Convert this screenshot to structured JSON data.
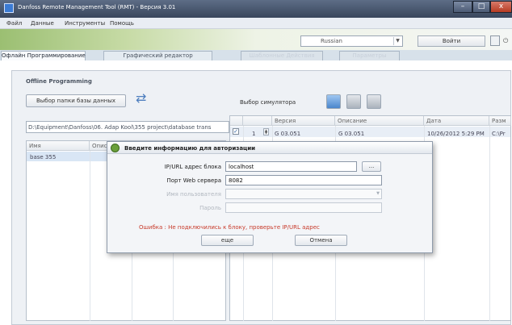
{
  "window": {
    "title": "Danfoss Remote Management Tool (RMT) - Версия 3.01",
    "controls": {
      "minimize": "–",
      "maximize": "□",
      "close": "x"
    }
  },
  "menu": [
    "Файл",
    "Данные",
    "Инструменты",
    "Помощь"
  ],
  "header": {
    "language": "Russian",
    "login_button": "Войти",
    "power_glyph": "⏻"
  },
  "tabs": [
    {
      "label": "Офлайн Программирование",
      "state": "active"
    },
    {
      "label": "Графический редактор",
      "state": "normal"
    },
    {
      "label": "Шаблонные Действия",
      "state": "disabled"
    },
    {
      "label": "Параметры",
      "state": "disabled"
    }
  ],
  "offline": {
    "section_title": "Offline Programming",
    "select_db_button": "Выбор папки базы данных",
    "refresh_glyph": "⇄",
    "emulator_label": "Выбор симулятора",
    "db_path": "D:\\Equipment\\Danfoss\\06. Adap Kool\\355 project\\database trans"
  },
  "left_table": {
    "columns": [
      "Имя",
      "Описа"
    ],
    "rows": [
      {
        "name": "base 355"
      }
    ]
  },
  "right_table": {
    "columns": [
      "",
      "",
      "Версия",
      "Описание",
      "Дата",
      "Разм"
    ],
    "rows": [
      {
        "checked": true,
        "number": "1",
        "version": "G 03.051",
        "description": "G 03.051",
        "date": "10/26/2012 5:29 PM",
        "path": "C:\\Pr"
      }
    ]
  },
  "dialog": {
    "title": "Введите информацию для авторизации",
    "ip_label": "IP/URL адрес блока",
    "ip_value": "localhost",
    "browse_button": "...",
    "port_label": "Порт Web сервера",
    "port_value": "8082",
    "user_label": "Имя пользователя",
    "user_value": "",
    "password_label": "Пароль",
    "password_value": "",
    "error": "Ошибка : Не подключились к блоку, проверьте  IP/URL адрес",
    "retry_button": "еще",
    "cancel_button": "Отмена"
  },
  "colors": {
    "error": "#c83a2a",
    "selection": "#d9e6f5",
    "titlebar": "#39465c"
  }
}
